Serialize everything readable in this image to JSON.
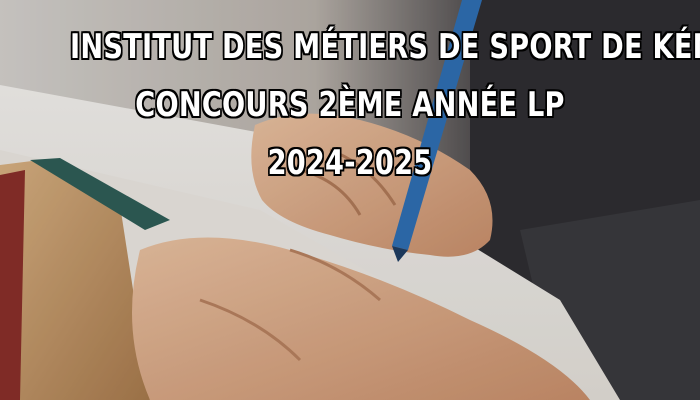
{
  "headline": {
    "line1": "INSTITUT DES MÉTIERS DE SPORT DE KÉNITRA",
    "line2": "CONCOURS 2ÈME ANNÉE LP",
    "line3": "2024-2025"
  },
  "colors": {
    "headline_text": "#ffffff",
    "headline_outline": "#000000",
    "background_left": "#d8d4cf",
    "background_right": "#2e2d31",
    "notebook_cover": "#c69a6a",
    "notebook_spine": "#2f5e57",
    "pen": "#2f6fb3",
    "skin": "#e2b38f"
  },
  "image": {
    "subject": "hands writing in a notebook with a blue pen"
  }
}
